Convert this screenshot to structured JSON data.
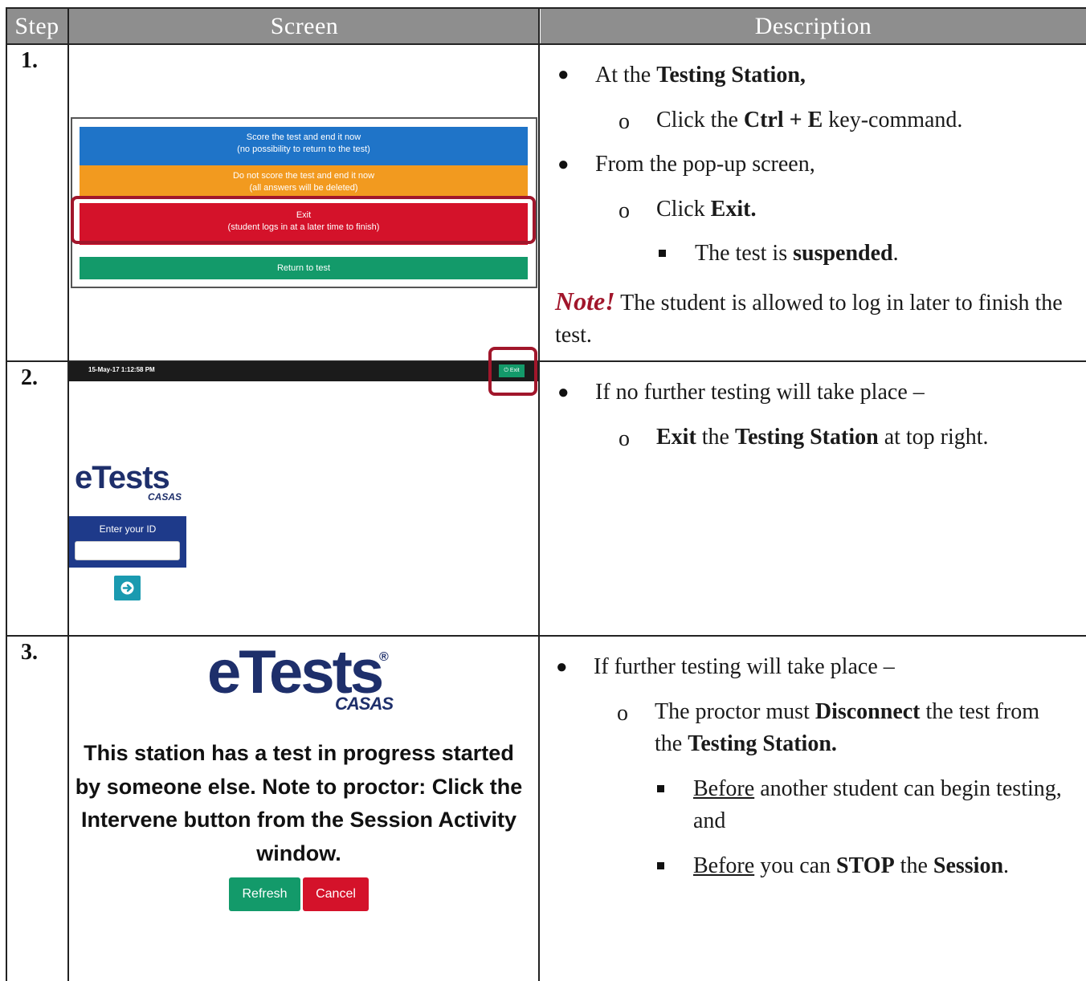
{
  "headers": {
    "step": "Step",
    "screen": "Screen",
    "description": "Description"
  },
  "steps": [
    {
      "number": "1.",
      "screen": {
        "buttons": [
          {
            "line1": "Score the test and end it now",
            "line2": "(no possibility to return to the test)",
            "color": "#1f74c8"
          },
          {
            "line1": "Do not score the test and end it now",
            "line2": "(all answers will be deleted)",
            "color": "#f29a1f"
          },
          {
            "line1": "Exit",
            "line2": "(student logs in at a later time to finish)",
            "color": "#d4122a"
          },
          {
            "line1": "Return to test",
            "line2": "",
            "color": "#139a6a"
          }
        ],
        "highlight_color": "#a1162b"
      },
      "description": {
        "b1_pre": "At the ",
        "b1_bold": "Testing Station,",
        "b1a_pre": "Click the ",
        "b1a_bold": "Ctrl + E",
        "b1a_post": " key-command.",
        "b2": "From the pop-up screen,",
        "b2a_pre": "Click ",
        "b2a_bold": "Exit.",
        "b2a1_pre": "The test is ",
        "b2a1_bold": "suspended",
        "b2a1_post": ".",
        "note_label": "Note!",
        "note_text": " The student is allowed to log in later to finish the test."
      }
    },
    {
      "number": "2.",
      "screen": {
        "timestamp": "15-May-17 1:12:58 PM",
        "exit_label": "⏻ Exit",
        "logo_main": "eTests",
        "logo_sub": "CASAS",
        "id_label": "Enter your ID",
        "id_placeholder": ""
      },
      "description": {
        "b1": "If no further testing will take place –",
        "b1a_bold1": "Exit",
        "b1a_mid": " the ",
        "b1a_bold2": "Testing Station",
        "b1a_post": " at top right."
      }
    },
    {
      "number": "3.",
      "screen": {
        "logo_main": "eTests",
        "logo_sub": "CASAS",
        "message": "This station has a test in progress started by someone else. Note to proctor: Click the Intervene button from the Session Activity window.",
        "refresh_label": "Refresh",
        "cancel_label": "Cancel"
      },
      "description": {
        "b1": "If further testing will take place –",
        "b1a_pre": "The proctor must ",
        "b1a_bold": "Disconnect",
        "b1a_mid": " the test from the ",
        "b1a_bold2": "Testing Station.",
        "b1a1_u": "Before",
        "b1a1_post": " another student can begin testing, and",
        "b1a2_u": "Before",
        "b1a2_mid": " you can ",
        "b1a2_bold": "STOP",
        "b1a2_mid2": " the ",
        "b1a2_bold2": "Session",
        "b1a2_post": "."
      }
    }
  ]
}
